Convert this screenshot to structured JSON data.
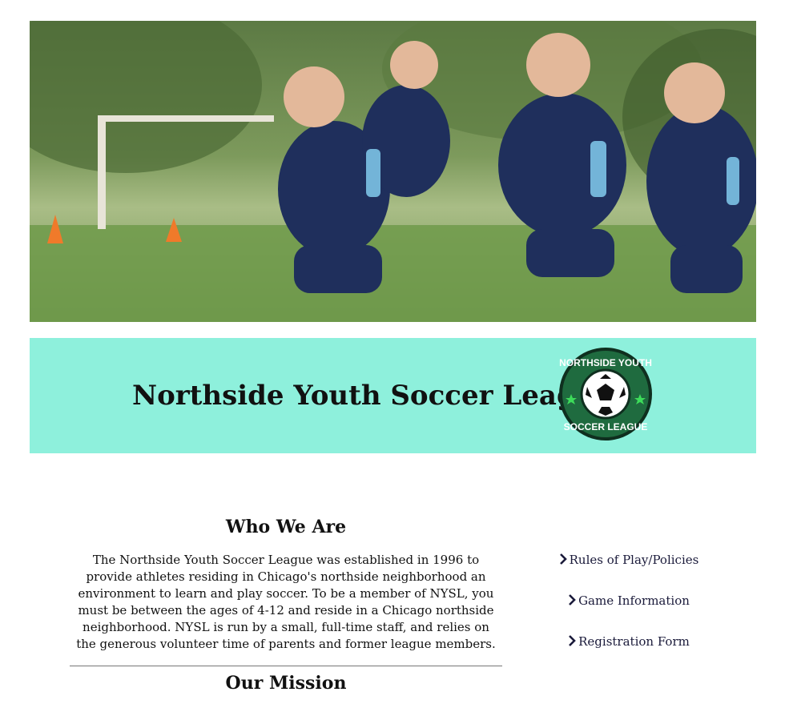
{
  "hero": {
    "alt": "Youth soccer players running"
  },
  "banner": {
    "title": "Northside Youth Soccer League",
    "logo_text_top": "NORTHSIDE YOUTH",
    "logo_text_bottom": "SOCCER LEAGUE"
  },
  "who": {
    "heading": "Who We Are",
    "body": "The Northside Youth Soccer League was established in 1996 to provide athletes residing in Chicago's northside neighborhood an environment to learn and play soccer. To be a member of NYSL, you must be between the ages of 4-12 and reside in a Chicago northside neighborhood. NYSL is run by a small, full-time staff, and relies on the generous volunteer time of parents and former league members."
  },
  "mission": {
    "heading": "Our Mission"
  },
  "links": [
    {
      "label": "Rules of Play/Policies",
      "icon": "chevron-right-icon"
    },
    {
      "label": "Game Information",
      "icon": "chevron-right-icon"
    },
    {
      "label": "Registration Form",
      "icon": "chevron-right-icon"
    }
  ],
  "colors": {
    "banner_bg": "#8ef0dc",
    "logo_green": "#1f6b3f",
    "link_text": "#1a1a3a"
  }
}
